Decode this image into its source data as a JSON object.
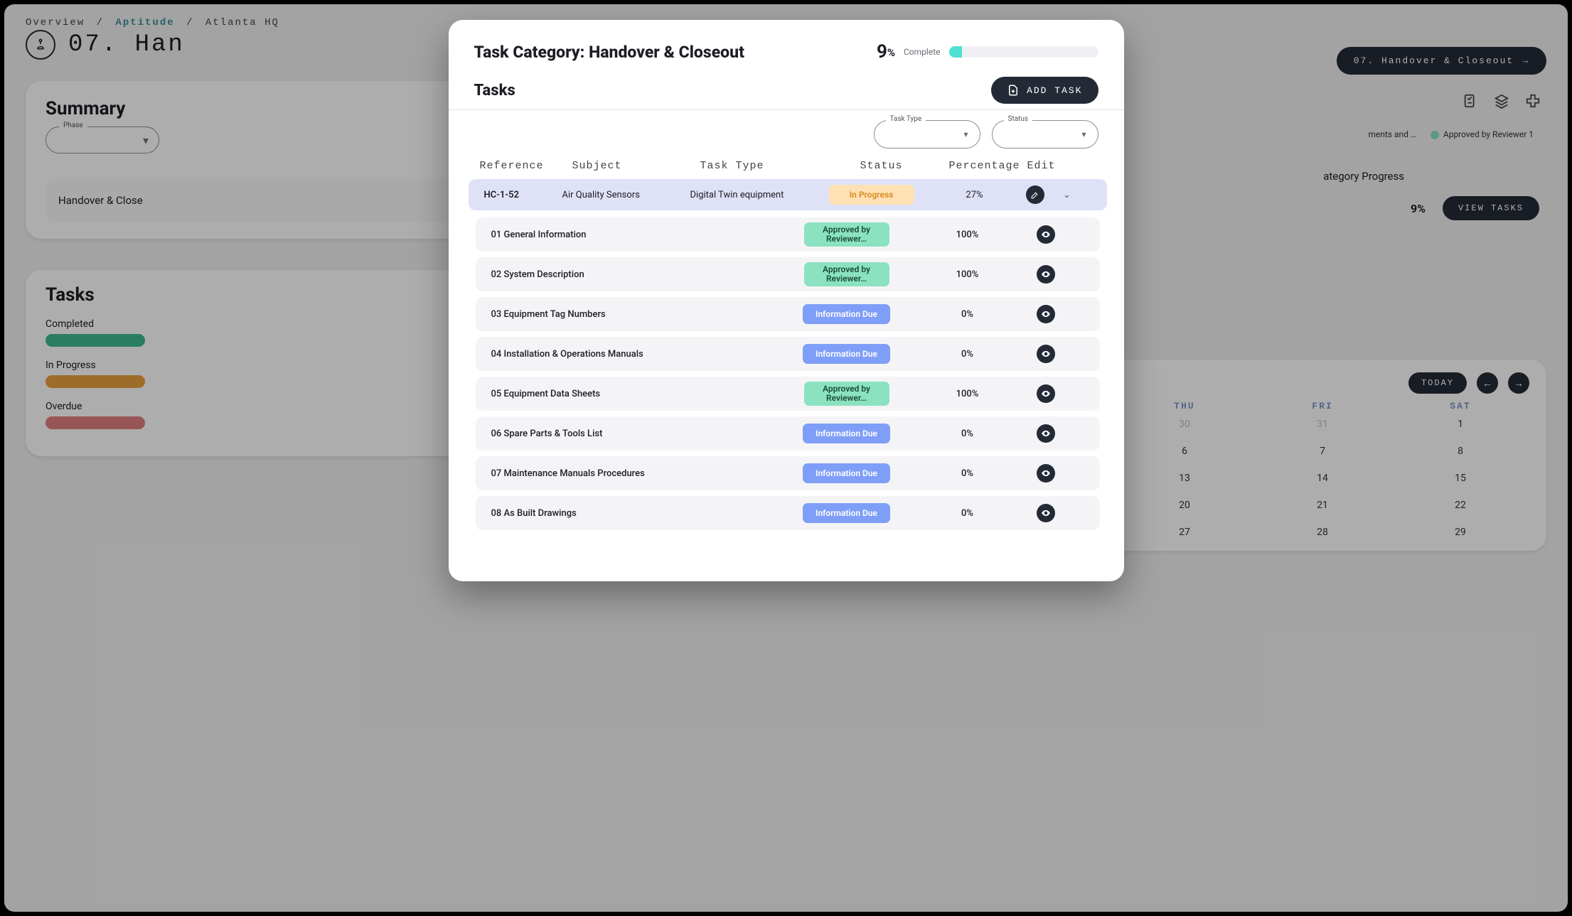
{
  "breadcrumb": {
    "a": "Overview",
    "b": "Aptitude",
    "c": "Atlanta HQ",
    "sep": "/"
  },
  "page_title": "07.  Han",
  "phase_pill": {
    "label": "07. Handover & Closeout",
    "arrow": "→"
  },
  "summary": {
    "title": "Summary",
    "phase_label": "Phase",
    "row_name": "Handover & Close",
    "cat_prog_label": "ategory Progress",
    "pct": "9%",
    "view_btn": "VIEW TASKS",
    "legend_a": "ments and …",
    "legend_b": "Approved by Reviewer 1"
  },
  "tasks_card": {
    "title": "Tasks",
    "completed": "Completed",
    "in_progress": "In Progress",
    "overdue": "Overdue"
  },
  "calendar": {
    "today": "TODAY",
    "days": [
      "THU",
      "FRI",
      "SAT"
    ],
    "grid": [
      [
        "30",
        "31",
        "1"
      ],
      [
        "6",
        "7",
        "8"
      ],
      [
        "13",
        "14",
        "15"
      ],
      [
        "20",
        "21",
        "22"
      ],
      [
        "27",
        "28",
        "29"
      ]
    ],
    "muted_idx": [
      0,
      1
    ]
  },
  "modal": {
    "title_prefix": "Task Category: ",
    "title": "Handover & Closeout",
    "percent": "9",
    "percent_sym": "%",
    "complete_label": "Complete",
    "tasks_label": "Tasks",
    "add_task": "ADD TASK",
    "filters": {
      "task_type": "Task Type",
      "status": "Status"
    },
    "columns": {
      "reference": "Reference",
      "subject": "Subject",
      "task_type": "Task Type",
      "status": "Status",
      "percentage": "Percentage",
      "edit": "Edit"
    },
    "status_labels": {
      "in_progress": "In Progress",
      "approved_line1": "Approved by",
      "approved_line2": "Reviewer…",
      "info_due": "Information Due"
    },
    "task": {
      "ref": "HC-1-52",
      "subject": "Air Quality Sensors",
      "type": "Digital Twin equipment",
      "status": "in_progress",
      "pct": "27%"
    },
    "subtasks": [
      {
        "label": "01 General Information",
        "status": "approved",
        "pct": "100%"
      },
      {
        "label": "02 System Description",
        "status": "approved",
        "pct": "100%"
      },
      {
        "label": "03 Equipment Tag Numbers",
        "status": "due",
        "pct": "0%"
      },
      {
        "label": "04 Installation & Operations Manuals",
        "status": "due",
        "pct": "0%"
      },
      {
        "label": "05 Equipment Data Sheets",
        "status": "approved",
        "pct": "100%"
      },
      {
        "label": "06 Spare Parts & Tools List",
        "status": "due",
        "pct": "0%"
      },
      {
        "label": "07 Maintenance Manuals Procedures",
        "status": "due",
        "pct": "0%"
      },
      {
        "label": "08 As Built Drawings",
        "status": "due",
        "pct": "0%"
      }
    ]
  }
}
